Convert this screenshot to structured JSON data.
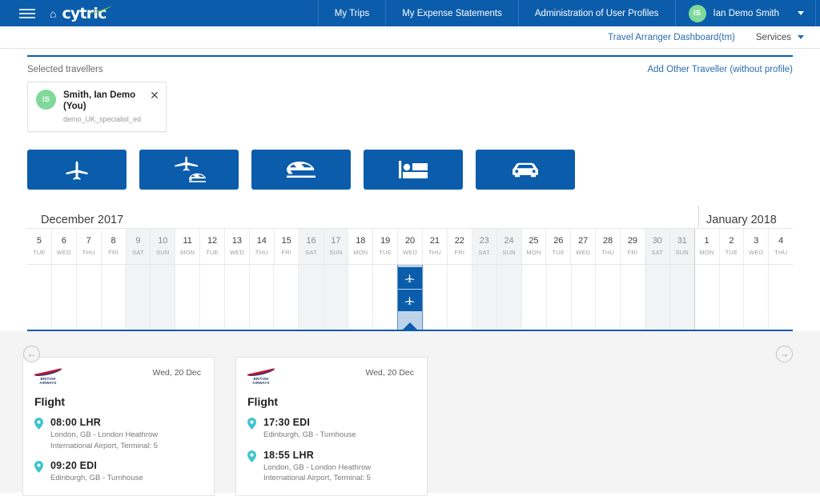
{
  "topnav": {
    "logo_text": "cytric",
    "home_icon": "home-icon",
    "menu_icon": "hamburger-icon",
    "items": [
      {
        "label": "My Trips"
      },
      {
        "label": "My Expense Statements"
      },
      {
        "label": "Administration of User Profiles"
      }
    ],
    "user": {
      "initials": "IS",
      "name": "Ian Demo Smith"
    }
  },
  "subnav": {
    "dashboard_label": "Travel Arranger Dashboard(tm)",
    "services_label": "Services"
  },
  "travellers": {
    "section_label": "Selected travellers",
    "add_link": "Add Other Traveller (without profile)",
    "chip": {
      "initials": "IS",
      "name": "Smith, Ian Demo (You)",
      "username": "demo_UK_specialist_ed",
      "close_icon": "close-icon"
    }
  },
  "services": [
    {
      "name": "flight-button",
      "icon": "airplane-icon"
    },
    {
      "name": "flight-plus-rail-button",
      "icon": "airplane-train-icon"
    },
    {
      "name": "rail-button",
      "icon": "train-icon"
    },
    {
      "name": "hotel-button",
      "icon": "bed-icon"
    },
    {
      "name": "car-button",
      "icon": "car-icon"
    }
  ],
  "timeline": {
    "month_left": "December 2017",
    "month_right": "January 2018",
    "days": [
      {
        "num": "5",
        "dow": "TUE",
        "weekend": false
      },
      {
        "num": "6",
        "dow": "WED",
        "weekend": false
      },
      {
        "num": "7",
        "dow": "THU",
        "weekend": false
      },
      {
        "num": "8",
        "dow": "FRI",
        "weekend": false
      },
      {
        "num": "9",
        "dow": "SAT",
        "weekend": true
      },
      {
        "num": "10",
        "dow": "SUN",
        "weekend": true
      },
      {
        "num": "11",
        "dow": "MON",
        "weekend": false
      },
      {
        "num": "12",
        "dow": "TUE",
        "weekend": false
      },
      {
        "num": "13",
        "dow": "WED",
        "weekend": false
      },
      {
        "num": "14",
        "dow": "THU",
        "weekend": false
      },
      {
        "num": "15",
        "dow": "FRI",
        "weekend": false
      },
      {
        "num": "16",
        "dow": "SAT",
        "weekend": true
      },
      {
        "num": "17",
        "dow": "SUN",
        "weekend": true
      },
      {
        "num": "18",
        "dow": "MON",
        "weekend": false
      },
      {
        "num": "19",
        "dow": "TUE",
        "weekend": false
      },
      {
        "num": "20",
        "dow": "WED",
        "weekend": false,
        "active": true,
        "events": [
          "airplane-icon",
          "airplane-icon"
        ]
      },
      {
        "num": "21",
        "dow": "THU",
        "weekend": false
      },
      {
        "num": "22",
        "dow": "FRI",
        "weekend": false
      },
      {
        "num": "23",
        "dow": "SAT",
        "weekend": true
      },
      {
        "num": "24",
        "dow": "SUN",
        "weekend": true
      },
      {
        "num": "25",
        "dow": "MON",
        "weekend": false
      },
      {
        "num": "26",
        "dow": "TUE",
        "weekend": false
      },
      {
        "num": "27",
        "dow": "WED",
        "weekend": false
      },
      {
        "num": "28",
        "dow": "THU",
        "weekend": false
      },
      {
        "num": "29",
        "dow": "FRI",
        "weekend": false
      },
      {
        "num": "30",
        "dow": "SAT",
        "weekend": true
      },
      {
        "num": "31",
        "dow": "SUN",
        "weekend": true
      },
      {
        "num": "1",
        "dow": "MON",
        "weekend": false,
        "month_start": true
      },
      {
        "num": "2",
        "dow": "TUE",
        "weekend": false
      },
      {
        "num": "3",
        "dow": "WED",
        "weekend": false
      },
      {
        "num": "4",
        "dow": "THU",
        "weekend": false
      }
    ]
  },
  "carousel": {
    "prev_icon": "arrow-left-icon",
    "next_icon": "arrow-right-icon",
    "prev_glyph": "←",
    "next_glyph": "→"
  },
  "cards": [
    {
      "airline": "BRITISH\nAIRWAYS",
      "airline_line1": "BRITISH",
      "airline_line2": "AIRWAYS",
      "date": "Wed, 20 Dec",
      "title": "Flight",
      "legs": [
        {
          "time": "08:00 LHR",
          "desc_line1": "London, GB - London Heathrow",
          "desc_line2": "International Airport, Terminal: 5"
        },
        {
          "time": "09:20 EDI",
          "desc_line1": "Edinburgh, GB - Turnhouse",
          "desc_line2": ""
        }
      ]
    },
    {
      "airline_line1": "BRITISH",
      "airline_line2": "AIRWAYS",
      "date": "Wed, 20 Dec",
      "title": "Flight",
      "legs": [
        {
          "time": "17:30 EDI",
          "desc_line1": "Edinburgh, GB - Turnhouse",
          "desc_line2": ""
        },
        {
          "time": "18:55 LHR",
          "desc_line1": "London, GB - London Heathrow",
          "desc_line2": "International Airport, Terminal: 5"
        }
      ]
    }
  ],
  "colors": {
    "brand_blue": "#0b5cab",
    "link_blue": "#2b6cb0",
    "avatar_green": "#7ed99a",
    "pin_teal": "#3ec5cf",
    "weekend_gray": "#f1f3f4",
    "active_column": "#bdd3ea"
  }
}
